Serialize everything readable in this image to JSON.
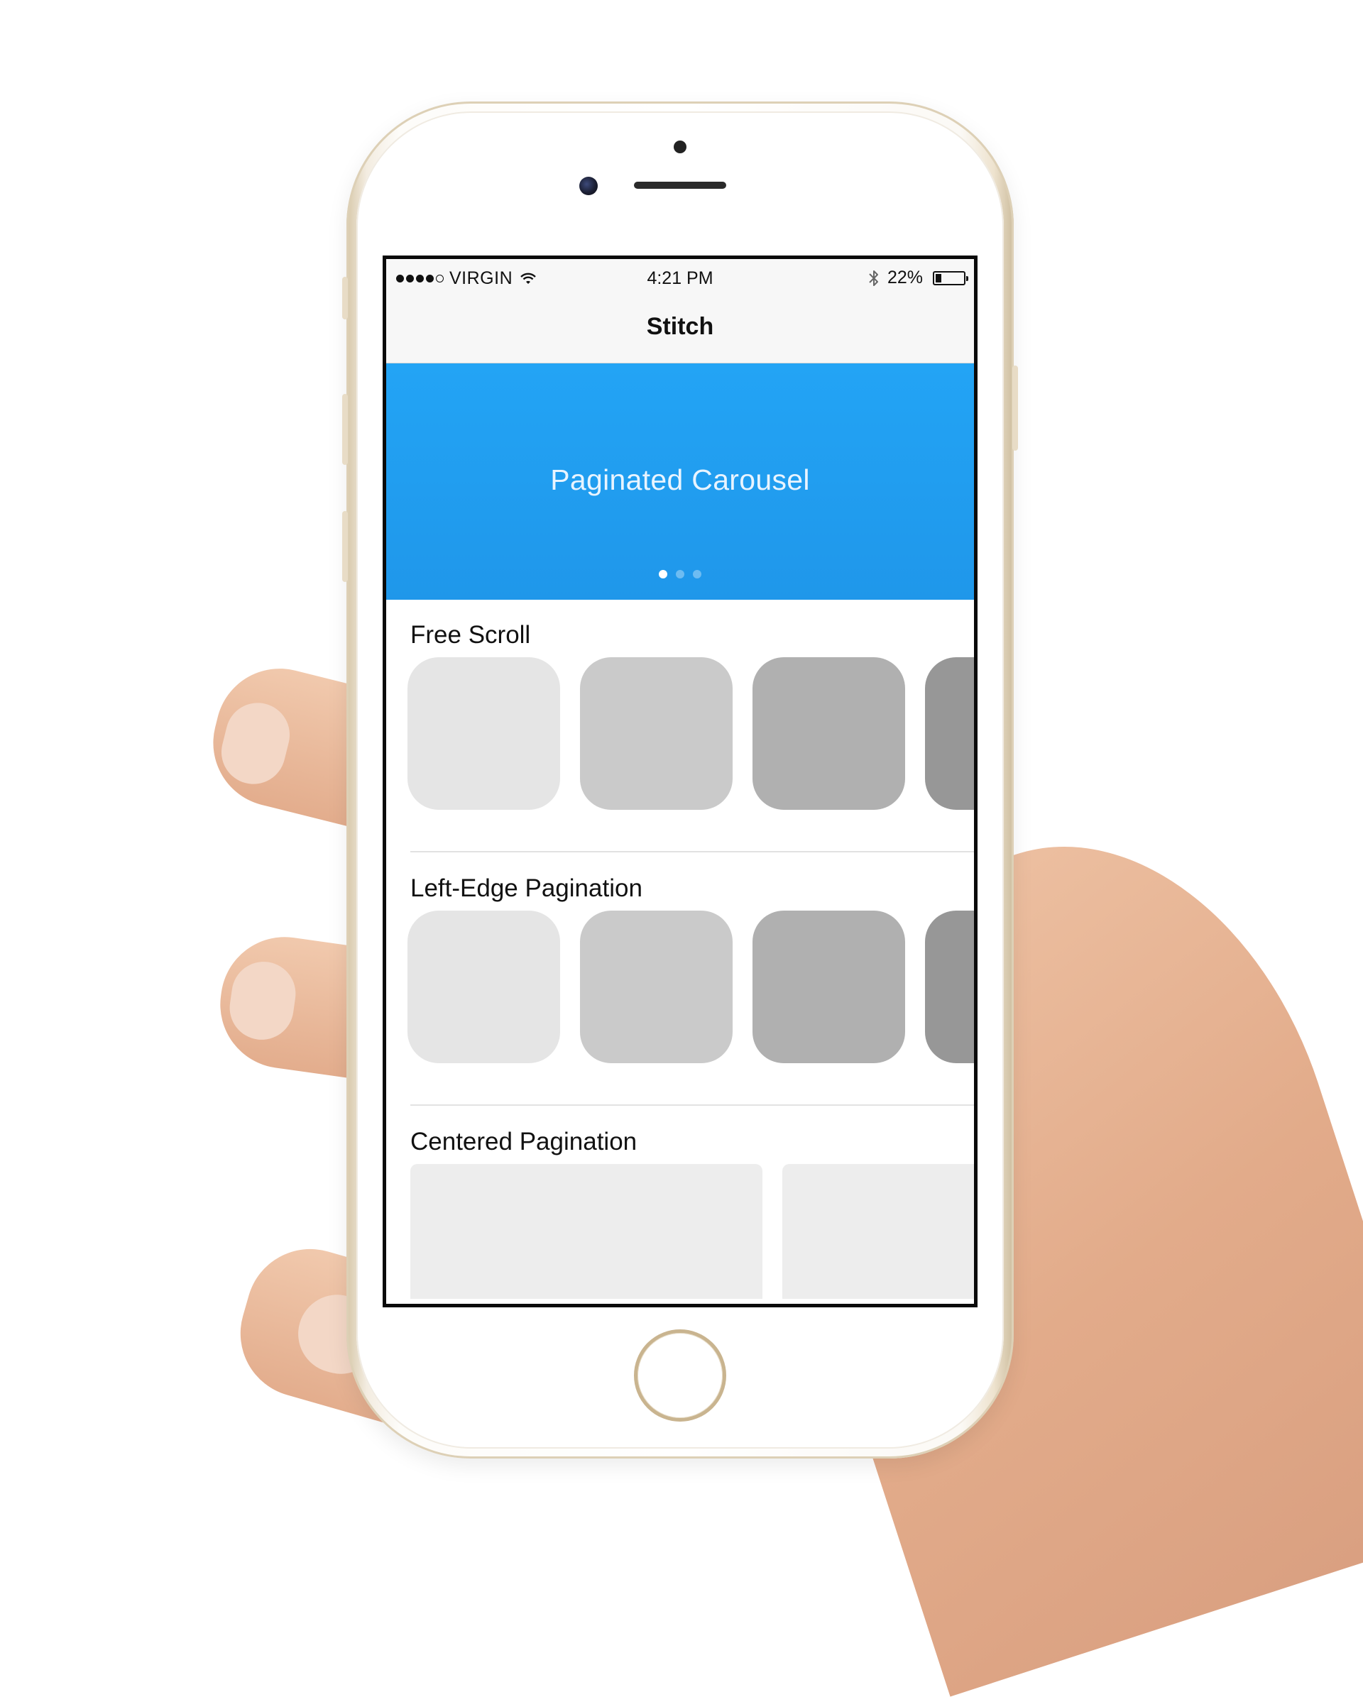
{
  "status_bar": {
    "carrier": "VIRGIN",
    "signal_bars_total": 5,
    "signal_bars_filled": 4,
    "time": "4:21 PM",
    "battery_text": "22%",
    "battery_level": 0.22,
    "wifi_icon": "wifi-icon",
    "bluetooth_icon": "bluetooth-icon"
  },
  "nav": {
    "title": "Stitch"
  },
  "hero": {
    "title": "Paginated Carousel",
    "page_count": 3,
    "active_page": 1,
    "color": "#1f97ea"
  },
  "sections": [
    {
      "title": "Free Scroll",
      "tile_colors": [
        "#e5e5e5",
        "#cacaca",
        "#b0b0b0",
        "#979797"
      ]
    },
    {
      "title": "Left-Edge Pagination",
      "tile_colors": [
        "#e5e5e5",
        "#cacaca",
        "#b0b0b0",
        "#979797"
      ]
    },
    {
      "title": "Centered Pagination",
      "card_color": "#ededed"
    }
  ]
}
